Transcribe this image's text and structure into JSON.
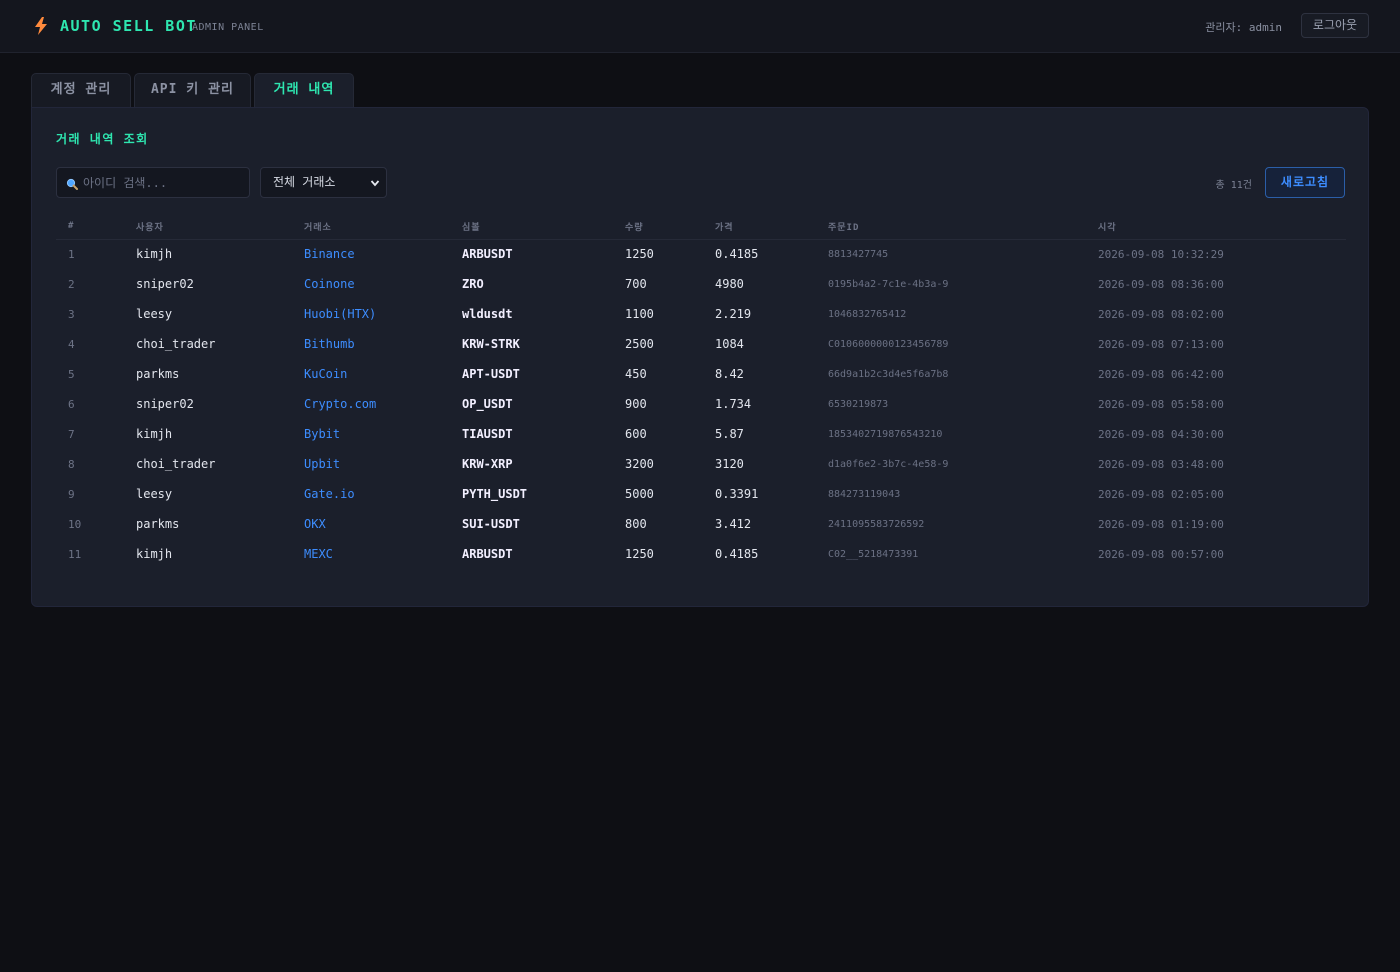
{
  "app": {
    "brand": "AUTO SELL BOT",
    "subtitle": "ADMIN PANEL",
    "admin_label": "관리자: admin",
    "logout_label": "로그아웃",
    "accent": "#2ee6b0",
    "link_color": "#3d8dff",
    "logo_icon": "lightning-icon"
  },
  "tabs": [
    {
      "label": "계정 관리",
      "active": false
    },
    {
      "label": "API 키 관리",
      "active": false
    },
    {
      "label": "거래 내역",
      "active": true
    }
  ],
  "panel": {
    "title": "거래 내역 조회",
    "search_placeholder": "아이디 검색...",
    "search_icon": "search-icon",
    "exchange_filter": "전체 거래소",
    "total_count": "총 11건",
    "refresh_label": "새로고침"
  },
  "table": {
    "headers": [
      "#",
      "사용자",
      "거래소",
      "심볼",
      "수량",
      "가격",
      "주문ID",
      "시각"
    ],
    "rows": [
      [
        "1",
        "kimjh",
        "Binance",
        "ARBUSDT",
        "1250",
        "0.4185",
        "8813427745",
        "2026-09-08 10:32:29"
      ],
      [
        "2",
        "sniper02",
        "Coinone",
        "ZRO",
        "700",
        "4980",
        "0195b4a2-7c1e-4b3a-9",
        "2026-09-08 08:36:00"
      ],
      [
        "3",
        "leesy",
        "Huobi(HTX)",
        "wldusdt",
        "1100",
        "2.219",
        "1046832765412",
        "2026-09-08 08:02:00"
      ],
      [
        "4",
        "choi_trader",
        "Bithumb",
        "KRW-STRK",
        "2500",
        "1084",
        "C0106000000123456789",
        "2026-09-08 07:13:00"
      ],
      [
        "5",
        "parkms",
        "KuCoin",
        "APT-USDT",
        "450",
        "8.42",
        "66d9a1b2c3d4e5f6a7b8",
        "2026-09-08 06:42:00"
      ],
      [
        "6",
        "sniper02",
        "Crypto.com",
        "OP_USDT",
        "900",
        "1.734",
        "6530219873",
        "2026-09-08 05:58:00"
      ],
      [
        "7",
        "kimjh",
        "Bybit",
        "TIAUSDT",
        "600",
        "5.87",
        "1853402719876543210",
        "2026-09-08 04:30:00"
      ],
      [
        "8",
        "choi_trader",
        "Upbit",
        "KRW-XRP",
        "3200",
        "3120",
        "d1a0f6e2-3b7c-4e58-9",
        "2026-09-08 03:48:00"
      ],
      [
        "9",
        "leesy",
        "Gate.io",
        "PYTH_USDT",
        "5000",
        "0.3391",
        "884273119043",
        "2026-09-08 02:05:00"
      ],
      [
        "10",
        "parkms",
        "OKX",
        "SUI-USDT",
        "800",
        "3.412",
        "2411095583726592",
        "2026-09-08 01:19:00"
      ],
      [
        "11",
        "kimjh",
        "MEXC",
        "ARBUSDT",
        "1250",
        "0.4185",
        "C02__5218473391",
        "2026-09-08 00:57:00"
      ]
    ]
  }
}
